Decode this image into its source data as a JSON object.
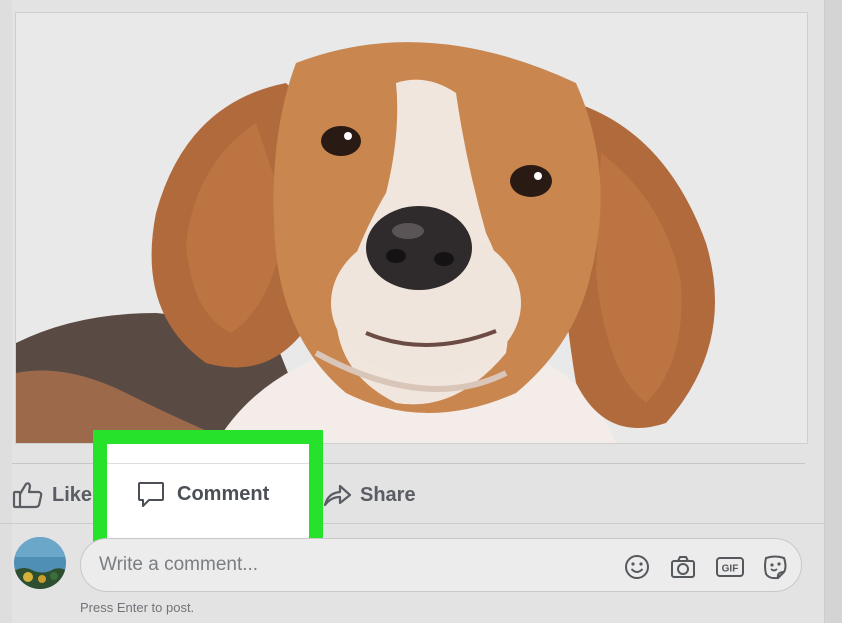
{
  "post": {
    "photo_alt": "beagle photo",
    "actions": {
      "like": "Like",
      "comment": "Comment",
      "share": "Share"
    }
  },
  "composer": {
    "placeholder": "Write a comment...",
    "hint": "Press Enter to post.",
    "icons": [
      "emoji-icon",
      "camera-icon",
      "gif-icon",
      "sticker-icon"
    ],
    "gif_label": "GIF"
  },
  "colors": {
    "highlight": "#27e22a",
    "action_text": "#5a5d63"
  }
}
